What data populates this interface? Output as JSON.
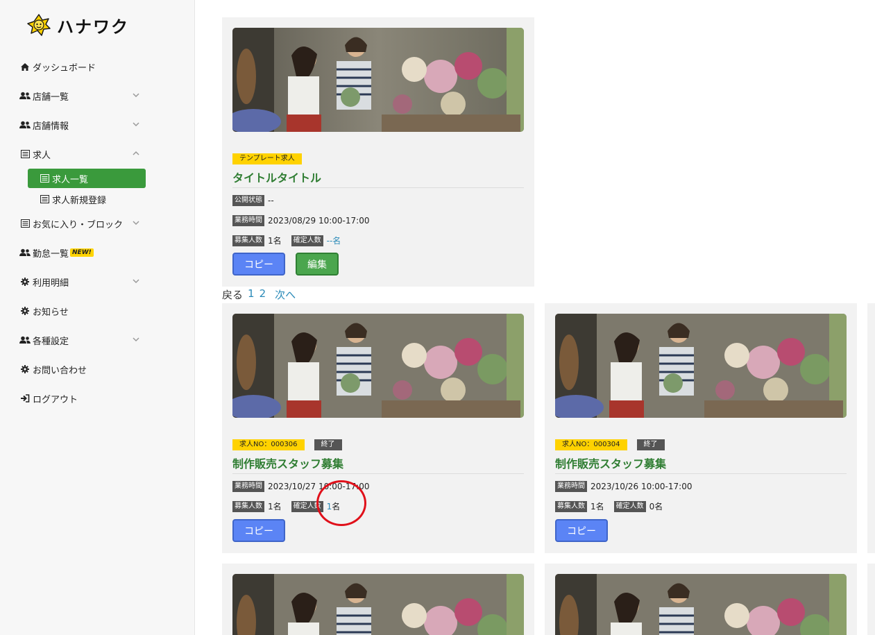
{
  "app": {
    "logo_text": "ハナワク"
  },
  "sidebar": {
    "items": [
      {
        "label": "ダッシュボード",
        "icon": "home-icon"
      },
      {
        "label": "店舗一覧",
        "icon": "users-icon"
      },
      {
        "label": "店舗情報",
        "icon": "users-icon"
      },
      {
        "label": "求人",
        "icon": "list-icon"
      },
      {
        "label": "求人一覧",
        "icon": "list-icon"
      },
      {
        "label": "求人新規登録",
        "icon": "list-icon"
      },
      {
        "label": "お気に入り・ブロック",
        "icon": "list-icon"
      },
      {
        "label": "勤怠一覧",
        "icon": "users-icon",
        "badge": "NEW!"
      },
      {
        "label": "利用明細",
        "icon": "gear-icon"
      },
      {
        "label": "お知らせ",
        "icon": "gear-icon"
      },
      {
        "label": "各種設定",
        "icon": "users-icon"
      },
      {
        "label": "お問い合わせ",
        "icon": "gear-icon"
      },
      {
        "label": "ログアウト",
        "icon": "logout-icon"
      }
    ]
  },
  "template_card": {
    "tag": "テンプレート求人",
    "title": "タイトルタイトル",
    "status_label": "公開状態",
    "status_value": "--",
    "hours_label": "業務時間",
    "hours_value": "2023/08/29 10:00-17:00",
    "recruit_label": "募集人数",
    "recruit_value": "1名",
    "confirmed_label": "確定人数",
    "confirmed_value": "--名",
    "copy_label": "コピー",
    "edit_label": "編集"
  },
  "pager": {
    "back": "戻る",
    "pages": [
      "1",
      "2"
    ],
    "next": "次へ"
  },
  "cards": [
    {
      "job_no": "求人NO：000306",
      "status": "終了",
      "title": "制作販売スタッフ募集",
      "hours_label": "業務時間",
      "hours_value": "2023/10/27 10:00-17:00",
      "recruit_label": "募集人数",
      "recruit_value": "1名",
      "confirmed_label": "確定人数",
      "confirmed_num": "1",
      "confirmed_unit": "名",
      "copy_label": "コピー"
    },
    {
      "job_no": "求人NO：000304",
      "status": "終了",
      "title": "制作販売スタッフ募集",
      "hours_label": "業務時間",
      "hours_value": "2023/10/26 10:00-17:00",
      "recruit_label": "募集人数",
      "recruit_value": "1名",
      "confirmed_label": "確定人数",
      "confirmed_num": "0",
      "confirmed_unit": "名",
      "copy_label": "コピー"
    }
  ],
  "colors": {
    "accent_green": "#3a9a3c",
    "title_green": "#2f7d32",
    "copy_blue": "#5b84f5",
    "tag_yellow": "#ffd200",
    "link_blue": "#2a8ab8",
    "annotation_red": "#e0101a"
  }
}
